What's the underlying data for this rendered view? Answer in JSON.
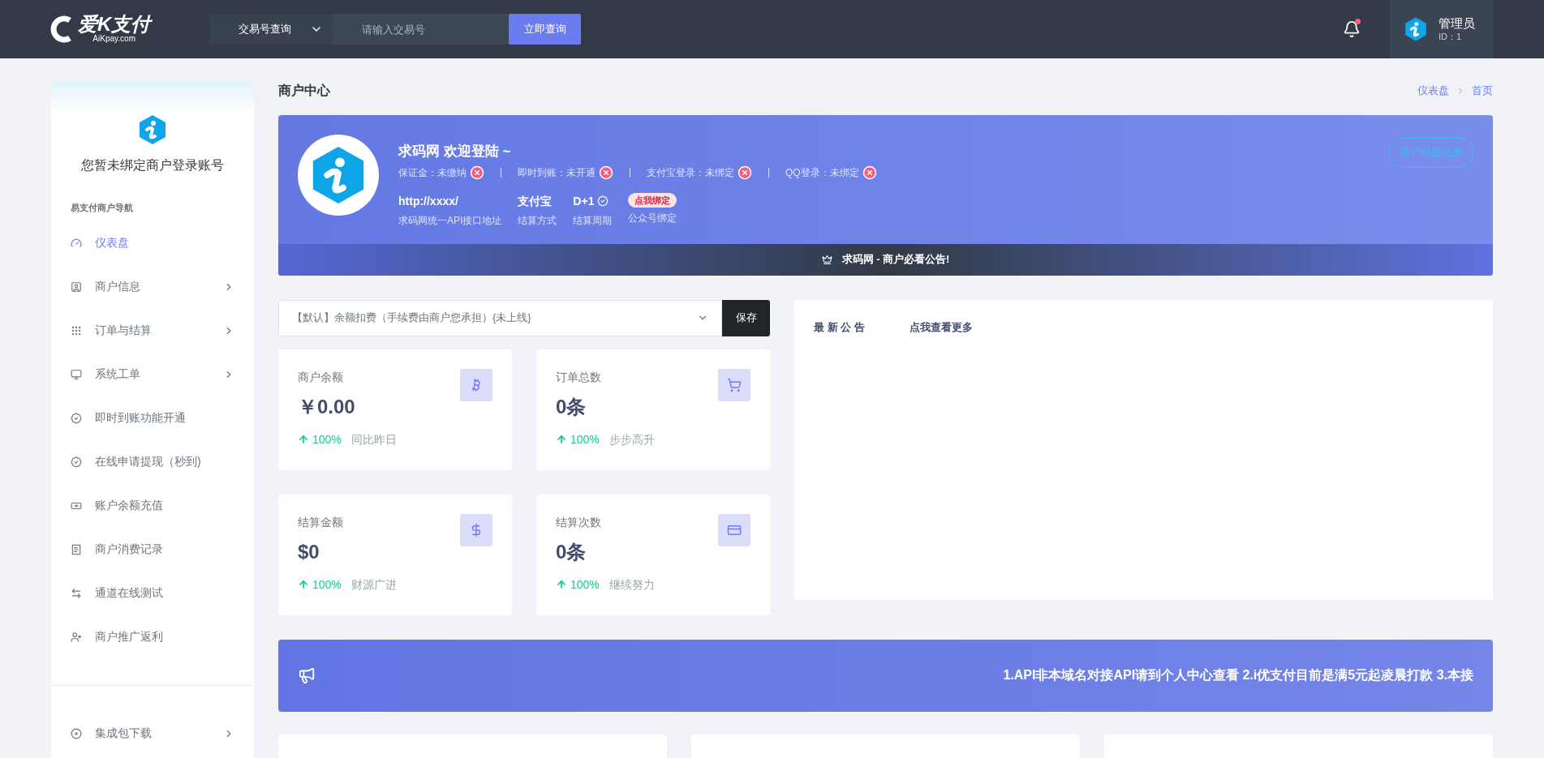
{
  "header": {
    "logo": {
      "name": "爱K支付",
      "subtitle": "AiKpay.com"
    },
    "search": {
      "select": "交易号查询",
      "placeholder": "请输入交易号",
      "button": "立即查询"
    },
    "user": {
      "name": "管理员",
      "id": "ID：1"
    }
  },
  "sidebar": {
    "profile_title": "您暂未绑定商户登录账号",
    "nav_heading": "易支付商户导航",
    "items": [
      {
        "label": "仪表盘",
        "selected": true,
        "submenu": false
      },
      {
        "label": "商户信息",
        "selected": false,
        "submenu": true
      },
      {
        "label": "订单与结算",
        "selected": false,
        "submenu": true
      },
      {
        "label": "系统工单",
        "selected": false,
        "submenu": true
      },
      {
        "label": "即时到账功能开通",
        "selected": false,
        "submenu": false
      },
      {
        "label": "在线申请提现（秒到)",
        "selected": false,
        "submenu": false
      },
      {
        "label": "账户余额充值",
        "selected": false,
        "submenu": false
      },
      {
        "label": "商户消费记录",
        "selected": false,
        "submenu": false
      },
      {
        "label": "通道在线测试",
        "selected": false,
        "submenu": false
      },
      {
        "label": "商户推广返利",
        "selected": false,
        "submenu": false
      }
    ],
    "footer_items": [
      {
        "label": "集成包下载",
        "selected": false,
        "submenu": true
      }
    ]
  },
  "page": {
    "title": "商户中心",
    "breadcrumb": [
      "仪表盘",
      "首页"
    ]
  },
  "banner": {
    "title": "求码网 欢迎登陆 ~",
    "statuses": [
      {
        "label": "保证金：未缴纳"
      },
      {
        "label": "即时到账：未开通"
      },
      {
        "label": "支付宝登录：未绑定"
      },
      {
        "label": "QQ登录：未绑定"
      }
    ],
    "info": [
      {
        "kind": "text",
        "value": "http://xxxx/",
        "caption": "求码网统一API接口地址"
      },
      {
        "kind": "text",
        "value": "支付宝",
        "caption": "结算方式"
      },
      {
        "kind": "verified",
        "value": "D+1",
        "caption": "结算周期"
      },
      {
        "kind": "badge",
        "value": "点我绑定",
        "caption": "公众号绑定"
      }
    ],
    "button": "商户对接信息",
    "notice": "求码网 - 商户必看公告!"
  },
  "settlement": {
    "value": "【默认】余额扣费（手续费由商户您承担）{未上线}",
    "button": "保存"
  },
  "stats": [
    {
      "label": "商户余额",
      "value": "￥0.00",
      "change": "100%",
      "note": "同比昨日"
    },
    {
      "label": "订单总数",
      "value": "0条",
      "change": "100%",
      "note": "步步高升"
    },
    {
      "label": "结算金额",
      "value": "$0",
      "change": "100%",
      "note": "财源广进"
    },
    {
      "label": "结算次数",
      "value": "0条",
      "change": "100%",
      "note": "继续努力"
    }
  ],
  "notice_card": {
    "title": "最 新 公 告",
    "more": "点我查看更多"
  },
  "marquee": "1.API非本域名对接API请到个人中心查看 2.i优支付目前是满5元起凌晨打款 3.本接"
}
